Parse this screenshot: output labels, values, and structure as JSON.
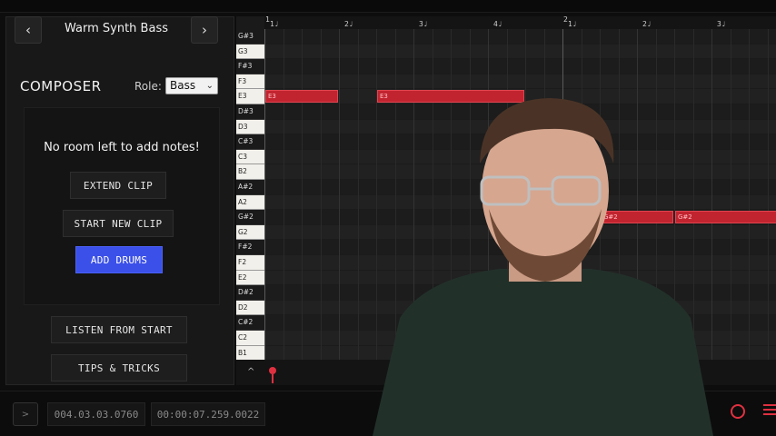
{
  "clip_nav": {
    "prev_glyph": "‹",
    "next_glyph": "›",
    "clip_name": "Warm Synth Bass"
  },
  "composer": {
    "title": "COMPOSER",
    "role_label": "Role:",
    "role_value": "Bass"
  },
  "message": {
    "text": "No room left to add notes!",
    "extend_clip": "EXTEND CLIP",
    "start_new_clip": "START NEW CLIP",
    "add_drums": "ADD DRUMS"
  },
  "actions": {
    "listen_from_start": "LISTEN FROM START",
    "tips_and_tricks": "TIPS & TRICKS"
  },
  "piano_roll": {
    "keys": [
      {
        "name": "G#3",
        "black": true
      },
      {
        "name": "G3",
        "black": false
      },
      {
        "name": "F#3",
        "black": true
      },
      {
        "name": "F3",
        "black": false
      },
      {
        "name": "E3",
        "black": false
      },
      {
        "name": "D#3",
        "black": true
      },
      {
        "name": "D3",
        "black": false
      },
      {
        "name": "C#3",
        "black": true
      },
      {
        "name": "C3",
        "black": false
      },
      {
        "name": "B2",
        "black": false
      },
      {
        "name": "A#2",
        "black": true
      },
      {
        "name": "A2",
        "black": false
      },
      {
        "name": "G#2",
        "black": true
      },
      {
        "name": "G2",
        "black": false
      },
      {
        "name": "F#2",
        "black": true
      },
      {
        "name": "F2",
        "black": false
      },
      {
        "name": "E2",
        "black": false
      },
      {
        "name": "D#2",
        "black": true
      },
      {
        "name": "D2",
        "black": false
      },
      {
        "name": "C#2",
        "black": true
      },
      {
        "name": "C2",
        "black": false
      },
      {
        "name": "B1",
        "black": false
      }
    ],
    "bars": [
      "1",
      "2"
    ],
    "beats": [
      "1",
      "2",
      "3",
      "4",
      "1",
      "2",
      "3"
    ],
    "notes": [
      {
        "label": "E3",
        "pitch": "E3",
        "start_beat": 0,
        "length_beats": 1
      },
      {
        "label": "E3",
        "pitch": "E3",
        "start_beat": 1.5,
        "length_beats": 2
      },
      {
        "label": "G#2",
        "pitch": "G#2",
        "start_beat": 4.5,
        "length_beats": 1
      },
      {
        "label": "G#2",
        "pitch": "G#2",
        "start_beat": 5.5,
        "length_beats": 1.5
      }
    ],
    "beats_visible": 7,
    "scroll_up_glyph": "^"
  },
  "transport": {
    "play_glyph": ">",
    "bars_counter": "004.03.03.0760",
    "time_counter": "00:00:07.259.0022"
  },
  "colors": {
    "note_red": "#c2242f",
    "accent_blue": "#3b50e8",
    "record_red": "#e03040"
  }
}
